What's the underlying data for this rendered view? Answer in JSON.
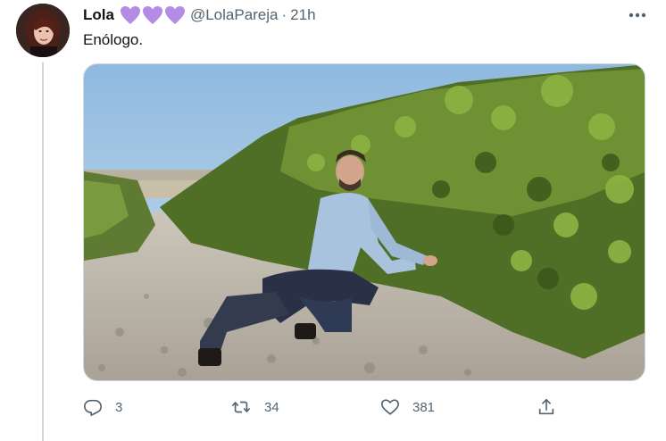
{
  "tweet": {
    "author_name": "Lola",
    "author_handle": "@LolaPareja",
    "separator": "·",
    "time": "21h",
    "text": "Enólogo.",
    "name_emojis": [
      "purple-heart",
      "purple-heart",
      "purple-heart"
    ],
    "emoji_color": "#b48ce6"
  },
  "actions": {
    "reply_count": "3",
    "retweet_count": "34",
    "like_count": "381"
  },
  "colors": {
    "text_primary": "#0f1419",
    "text_secondary": "#536471",
    "thread_line": "#cfd9de"
  },
  "icons": [
    "more-icon",
    "reply-icon",
    "retweet-icon",
    "like-icon",
    "share-icon"
  ]
}
